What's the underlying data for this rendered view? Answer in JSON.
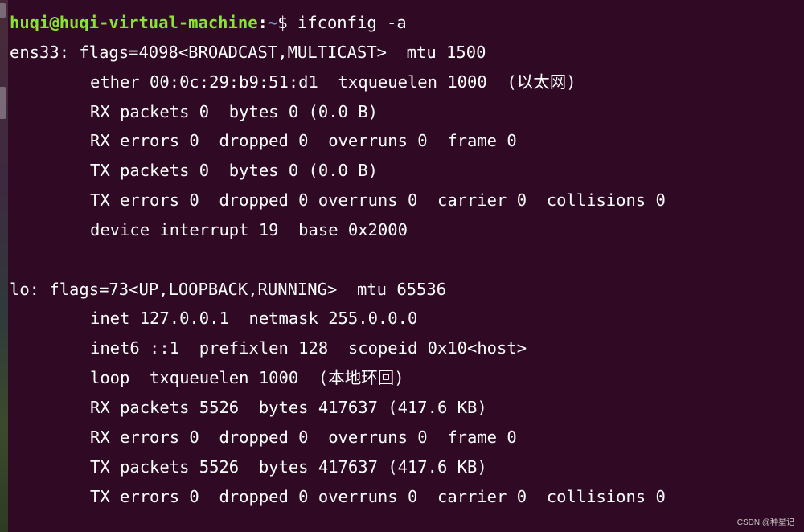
{
  "prompt": {
    "user_host": "huqi@huqi-virtual-machine",
    "colon": ":",
    "path": "~",
    "symbol": "$ ",
    "command": "ifconfig -a"
  },
  "output": {
    "ens33": {
      "header": "ens33: flags=4098<BROADCAST,MULTICAST>  mtu 1500",
      "lines": [
        "ether 00:0c:29:b9:51:d1  txqueuelen 1000  (以太网)",
        "RX packets 0  bytes 0 (0.0 B)",
        "RX errors 0  dropped 0  overruns 0  frame 0",
        "TX packets 0  bytes 0 (0.0 B)",
        "TX errors 0  dropped 0 overruns 0  carrier 0  collisions 0",
        "device interrupt 19  base 0x2000"
      ]
    },
    "lo": {
      "header": "lo: flags=73<UP,LOOPBACK,RUNNING>  mtu 65536",
      "lines": [
        "inet 127.0.0.1  netmask 255.0.0.0",
        "inet6 ::1  prefixlen 128  scopeid 0x10<host>",
        "loop  txqueuelen 1000  (本地环回)",
        "RX packets 5526  bytes 417637 (417.6 KB)",
        "RX errors 0  dropped 0  overruns 0  frame 0",
        "TX packets 5526  bytes 417637 (417.6 KB)",
        "TX errors 0  dropped 0 overruns 0  carrier 0  collisions 0"
      ]
    }
  },
  "watermark": "CSDN @种星记",
  "colors": {
    "background": "#300a24",
    "user_host": "#8ae234",
    "path": "#729fcf",
    "text": "#ffffff"
  }
}
